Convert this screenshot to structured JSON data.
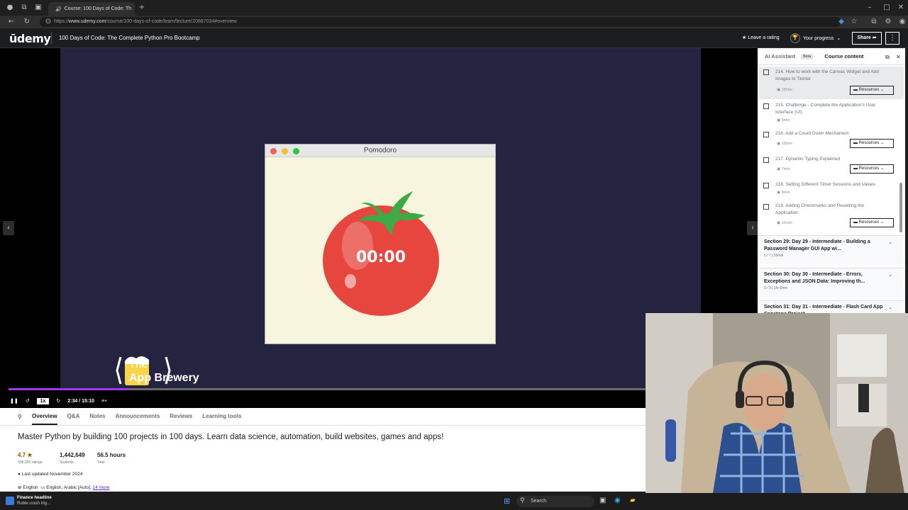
{
  "browser": {
    "tab_title": "Course: 100 Days of Code: Th",
    "url_prefix": "https://",
    "url_host": "www.udemy.com",
    "url_path": "/course/100-days-of-code/learn/lecture/20887034#overview"
  },
  "header": {
    "logo": "ūdemy",
    "course_title": "100 Days of Code: The Complete Python Pro Bootcamp",
    "leave_rating": "Leave a rating",
    "your_progress": "Your progress",
    "share": "Share"
  },
  "video": {
    "window_title": "Pomodoro",
    "timer": "00:00",
    "brand_the": "The",
    "brand_name": "App Brewery",
    "speed": "1x",
    "time": "2:34 / 15:10",
    "progress_fraction": 0.19
  },
  "tabs": [
    "Overview",
    "Q&A",
    "Notes",
    "Announcements",
    "Reviews",
    "Learning tools"
  ],
  "overview": {
    "headline": "Master Python by building 100 projects in 100 days. Learn data science, automation, build websites, games and apps!",
    "rating": "4.7 ★",
    "ratings_count": "338,253 ratings",
    "students": "1,442,649",
    "students_label": "Students",
    "hours": "56.5 hours",
    "hours_label": "Total",
    "updated": "Last updated November 2024",
    "lang": "English",
    "captions": "English, Arabic [Auto],",
    "more": "14 more"
  },
  "sidebar": {
    "tab_ai": "AI Assistant",
    "beta": "Beta",
    "tab_content": "Course content",
    "resources": "Resources",
    "lectures": [
      {
        "title": "214. How to work with the Canvas Widget and Add Images to Tkinter",
        "dur": "15min"
      },
      {
        "title": "215. Challenge - Complete the Application's User Interface (UI)",
        "dur": "9min"
      },
      {
        "title": "216. Add a Count Down Mechanism",
        "dur": "18min"
      },
      {
        "title": "217. Dynamic Typing Explained",
        "dur": "7min"
      },
      {
        "title": "218. Setting Different Timer Sessions and Values",
        "dur": "8min"
      },
      {
        "title": "219. Adding Checkmarks and Resetting the Application",
        "dur": "10min"
      }
    ],
    "sections": [
      {
        "title": "Section 29: Day 29 - Intermediate - Building a Password Manager GUI App wi...",
        "sub": "0 / 7 | 55min"
      },
      {
        "title": "Section 30: Day 30 - Intermediate - Errors, Exceptions and JSON Data: Improving th...",
        "sub": "0 / 9 | 1hr 6min"
      },
      {
        "title": "Section 31: Day 31 - Intermediate - Flash Card App Capstone Project",
        "sub": ""
      }
    ]
  },
  "taskbar": {
    "news_title": "Finance headline",
    "news_sub": "Ruble crash trig...",
    "search": "Search"
  },
  "colors": {
    "accent": "#a435f0",
    "stage": "#252440",
    "tomato": "#e7463f"
  }
}
